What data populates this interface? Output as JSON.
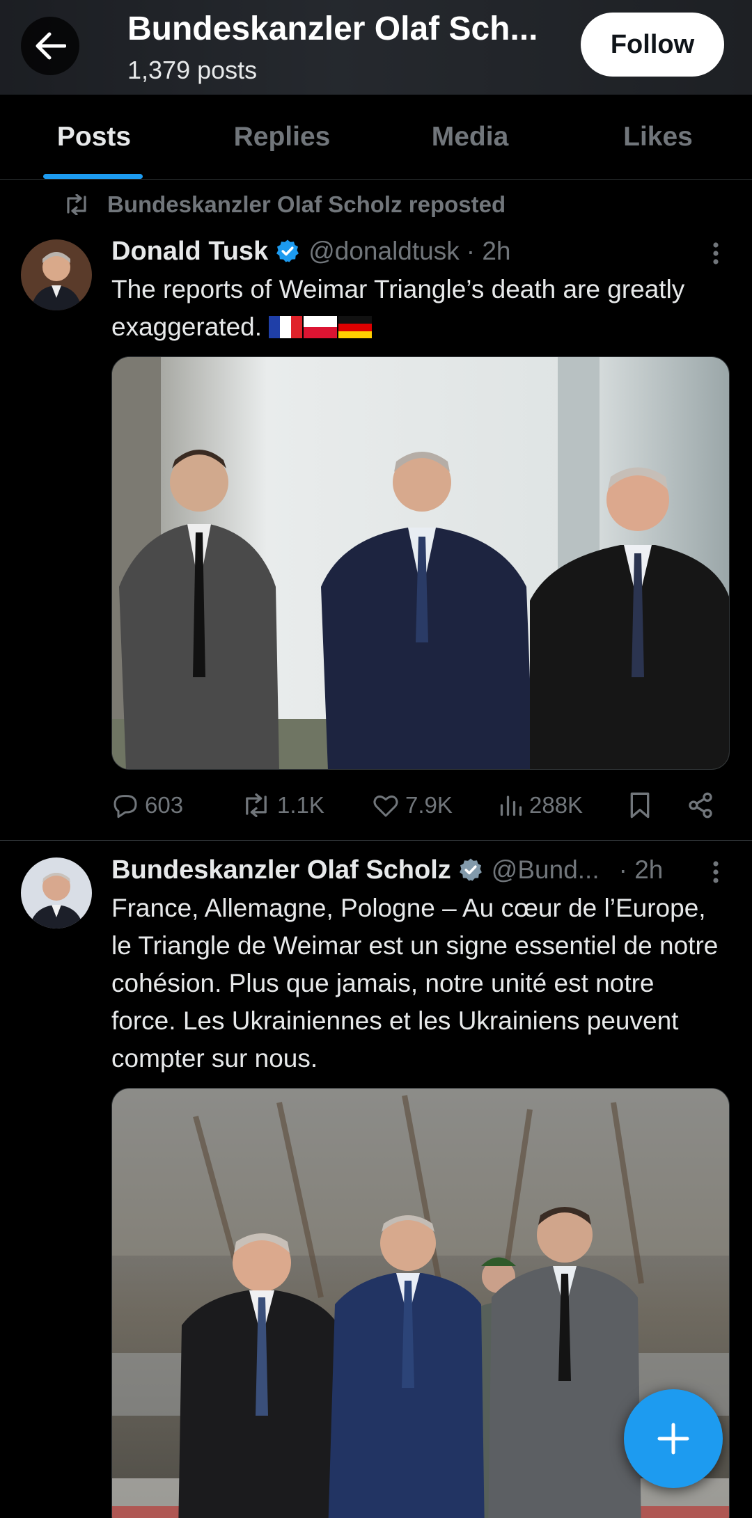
{
  "header": {
    "title": "Bundeskanzler Olaf Sch...",
    "post_count": "1,379 posts",
    "follow_label": "Follow"
  },
  "tabs": [
    {
      "label": "Posts",
      "active": true
    },
    {
      "label": "Replies",
      "active": false
    },
    {
      "label": "Media",
      "active": false
    },
    {
      "label": "Likes",
      "active": false
    }
  ],
  "posts": [
    {
      "repost_label": "Bundeskanzler Olaf Scholz reposted",
      "author": "Donald Tusk",
      "handle": "@donaldtusk",
      "time": "· 2h",
      "verified": true,
      "text": "The reports of Weimar Triangle’s death are greatly exaggerated.",
      "flags": [
        "fr",
        "pl",
        "de"
      ],
      "stats": {
        "replies": "603",
        "reposts": "1.1K",
        "likes": "7.9K",
        "views": "288K"
      }
    },
    {
      "author": "Bundeskanzler Olaf Scholz",
      "handle": "@Bund...",
      "time": "· 2h",
      "verified": true,
      "text": "France, Allemagne, Pologne – Au cœur de l’Europe, le Triangle de Weimar est un signe essentiel de notre cohésion. Plus que jamais, notre unité est notre force. Les Ukrainiennes et les Ukrainiens peuvent compter sur nous."
    }
  ],
  "colors": {
    "accent": "#1d9bf0",
    "background": "#000000",
    "text_primary": "#e7e9ea",
    "text_secondary": "#71767b"
  }
}
